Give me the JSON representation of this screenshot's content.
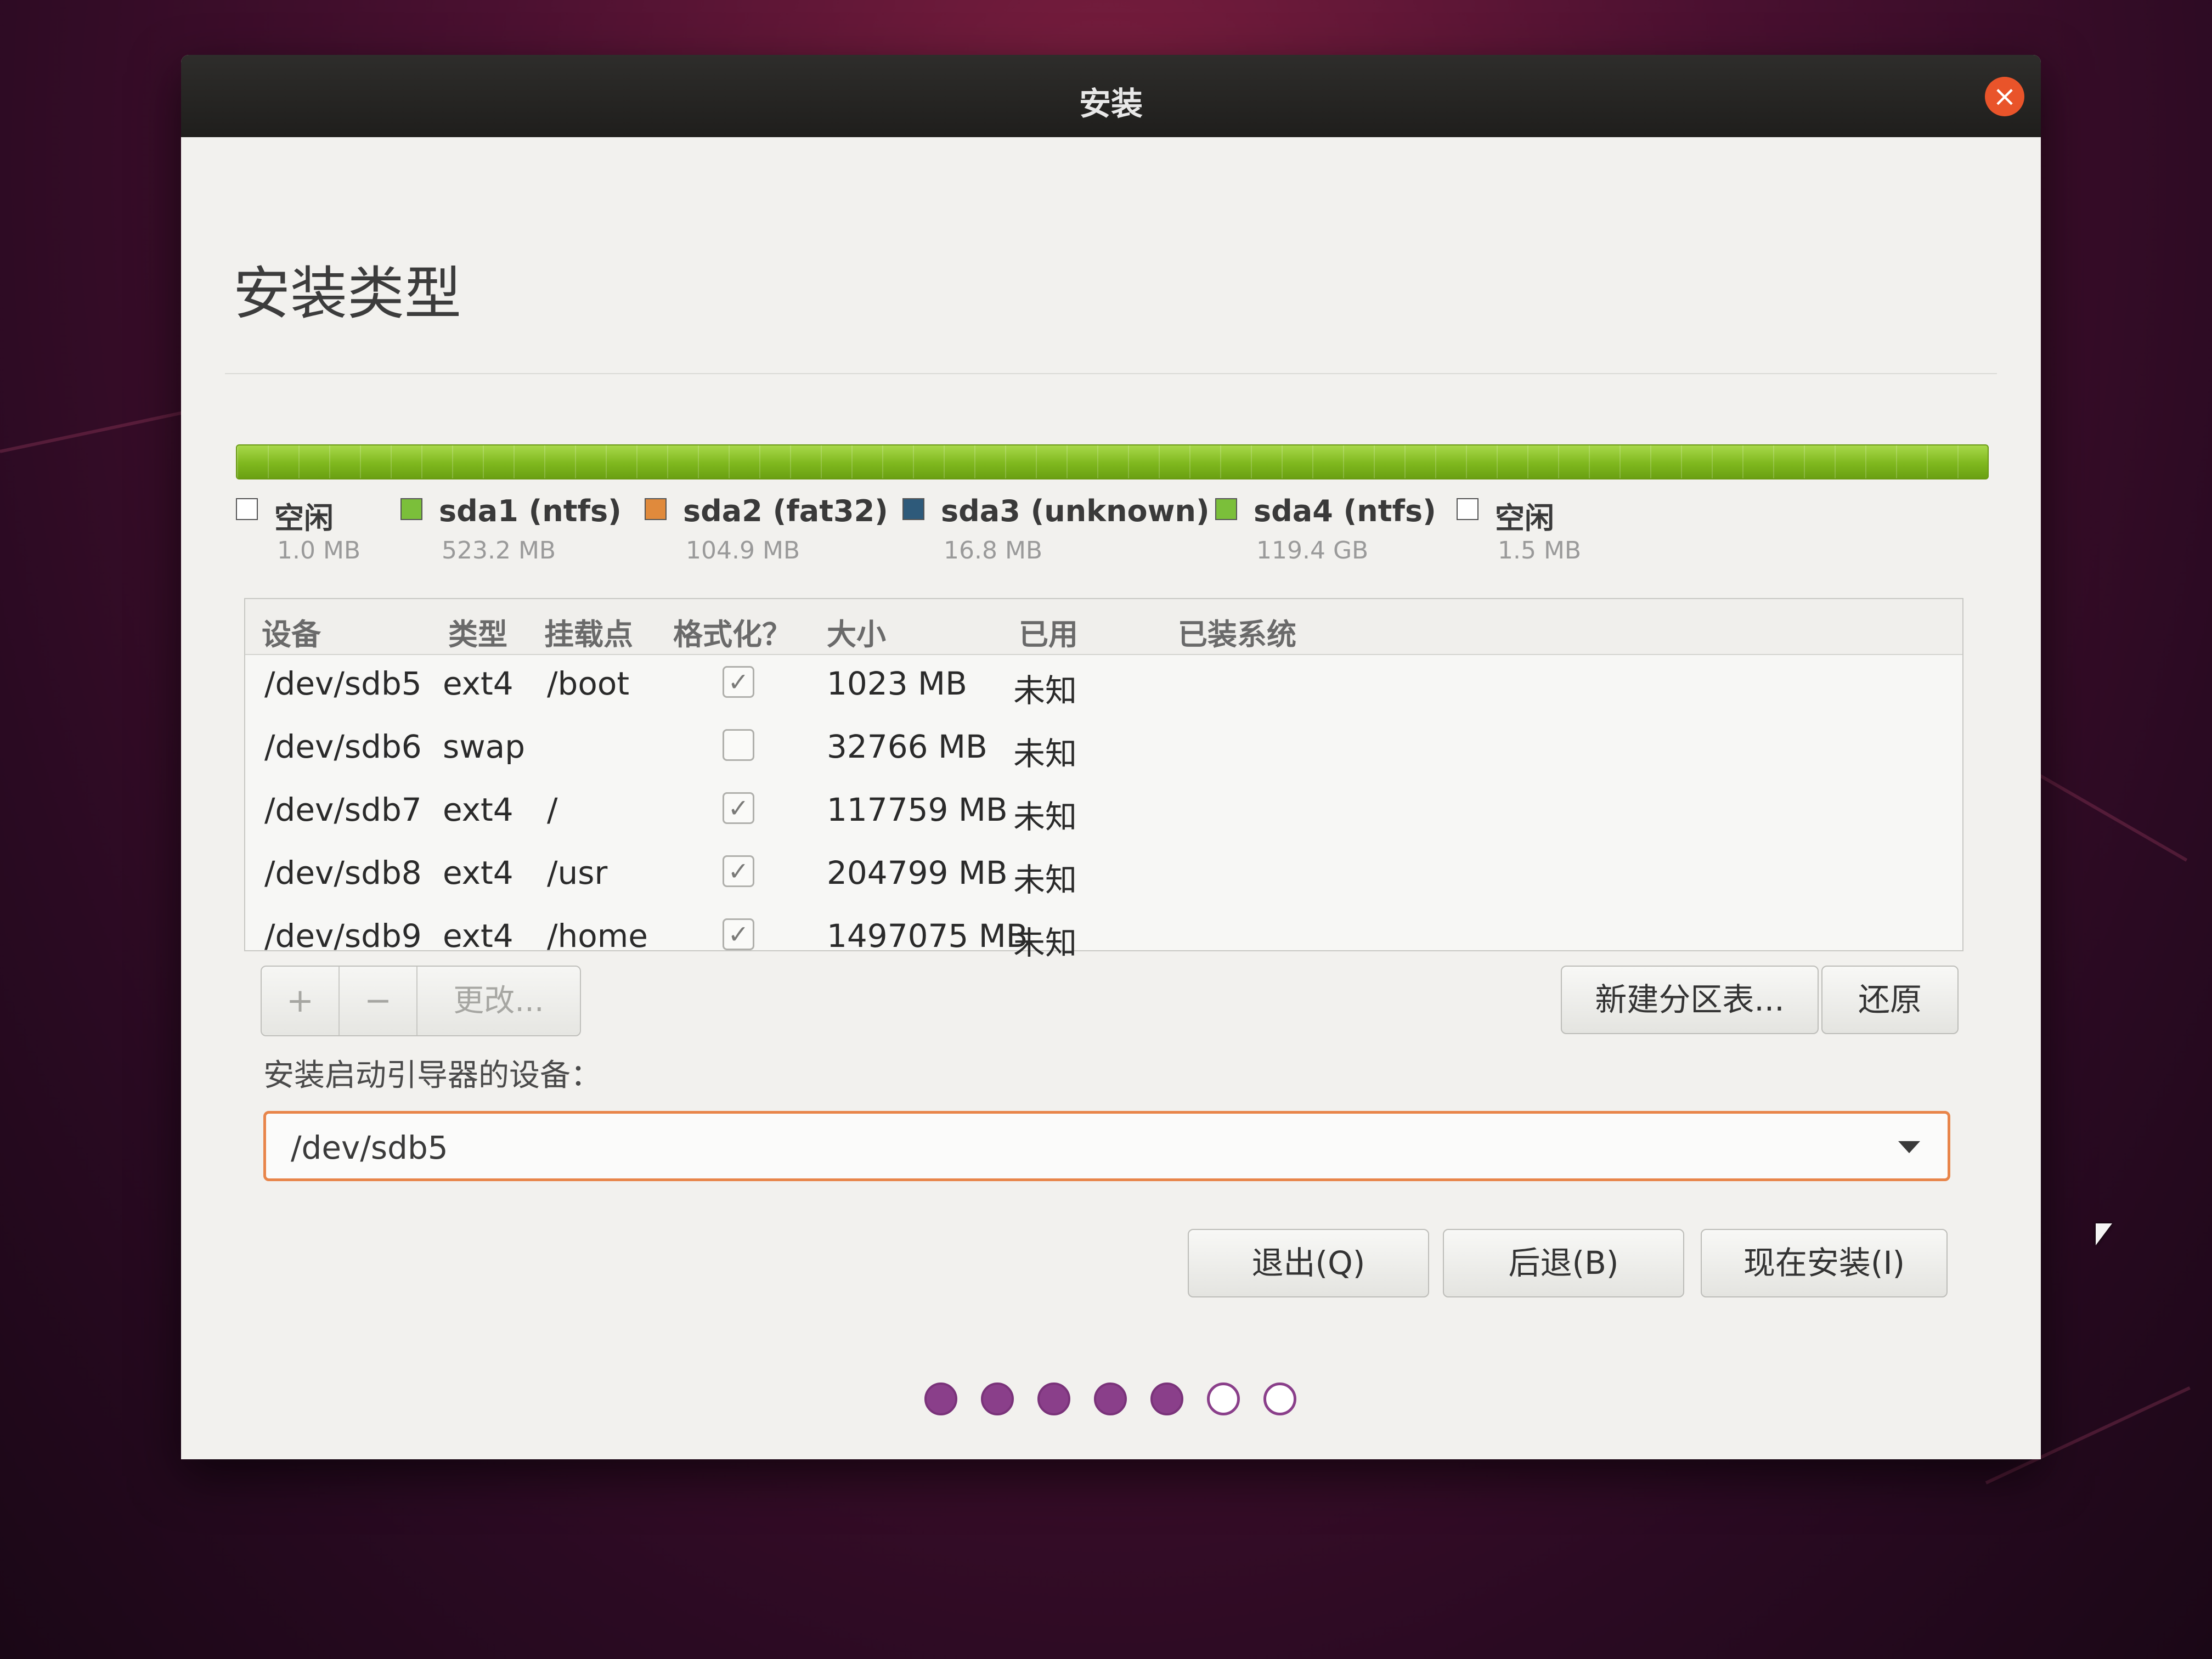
{
  "window": {
    "title": "安装",
    "close_icon": "×"
  },
  "page_title": "安装类型",
  "legend": [
    {
      "name": "空闲",
      "size": "1.0 MB",
      "color": "#ffffff"
    },
    {
      "name": "sda1 (ntfs)",
      "size": "523.2 MB",
      "color": "#7bbf3a"
    },
    {
      "name": "sda2 (fat32)",
      "size": "104.9 MB",
      "color": "#e08a3c"
    },
    {
      "name": "sda3 (unknown)",
      "size": "16.8 MB",
      "color": "#2e5a7a"
    },
    {
      "name": "sda4 (ntfs)",
      "size": "119.4 GB",
      "color": "#7bbf3a"
    },
    {
      "name": "空闲",
      "size": "1.5 MB",
      "color": "#ffffff"
    }
  ],
  "table": {
    "headers": [
      "设备",
      "类型",
      "挂载点",
      "格式化？",
      "大小",
      "已用",
      "已装系统"
    ],
    "rows": [
      {
        "device": "/dev/sdb5",
        "type": "ext4",
        "mount": "/boot",
        "format": true,
        "size": "1023 MB",
        "used": "未知",
        "system": ""
      },
      {
        "device": "/dev/sdb6",
        "type": "swap",
        "mount": "",
        "format": false,
        "size": "32766 MB",
        "used": "未知",
        "system": ""
      },
      {
        "device": "/dev/sdb7",
        "type": "ext4",
        "mount": "/",
        "format": true,
        "size": "117759 MB",
        "used": "未知",
        "system": ""
      },
      {
        "device": "/dev/sdb8",
        "type": "ext4",
        "mount": "/usr",
        "format": true,
        "size": "204799 MB",
        "used": "未知",
        "system": ""
      },
      {
        "device": "/dev/sdb9",
        "type": "ext4",
        "mount": "/home",
        "format": true,
        "size": "1497075 MB",
        "used": "未知",
        "system": ""
      }
    ]
  },
  "tools": {
    "add_label": "+",
    "remove_label": "−",
    "change_label": "更改..."
  },
  "new_partition_table_label": "新建分区表...",
  "revert_label": "还原",
  "bootloader": {
    "label": "安装启动引导器的设备：",
    "value": "/dev/sdb5"
  },
  "actions": {
    "quit_label": "退出(Q)",
    "back_label": "后退(B)",
    "install_label": "现在安装(I)"
  },
  "progress": {
    "completed_steps": 5,
    "total_steps": 7
  },
  "colors": {
    "accent": "#e8854a",
    "close": "#e9542a",
    "dot": "#8a3f8a"
  }
}
